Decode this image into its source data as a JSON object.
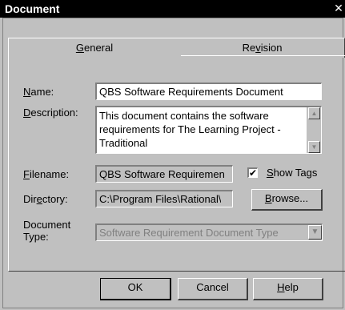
{
  "window": {
    "title": "Document",
    "close_glyph": "✕"
  },
  "tabs": [
    {
      "label": "General",
      "active": true
    },
    {
      "label": "Revision",
      "active": false
    }
  ],
  "form": {
    "name_label": "Name:",
    "name_value": "QBS Software Requirements Document",
    "description_label": "Description:",
    "description_value": "This document contains the software requirements for The Learning Project - Traditional",
    "filename_label": "Filename:",
    "filename_value": "QBS Software Requiremen",
    "show_tags_label": "Show Tags",
    "show_tags_checked": true,
    "directory_label": "Directory:",
    "directory_value": "C:\\Program Files\\Rational\\",
    "browse_label": "Browse...",
    "document_type_label_line1": "Document",
    "document_type_label_line2": "Type:",
    "document_type_value": "Software Requirement Document Type"
  },
  "buttons": {
    "ok": "OK",
    "cancel": "Cancel",
    "help": "Help"
  }
}
